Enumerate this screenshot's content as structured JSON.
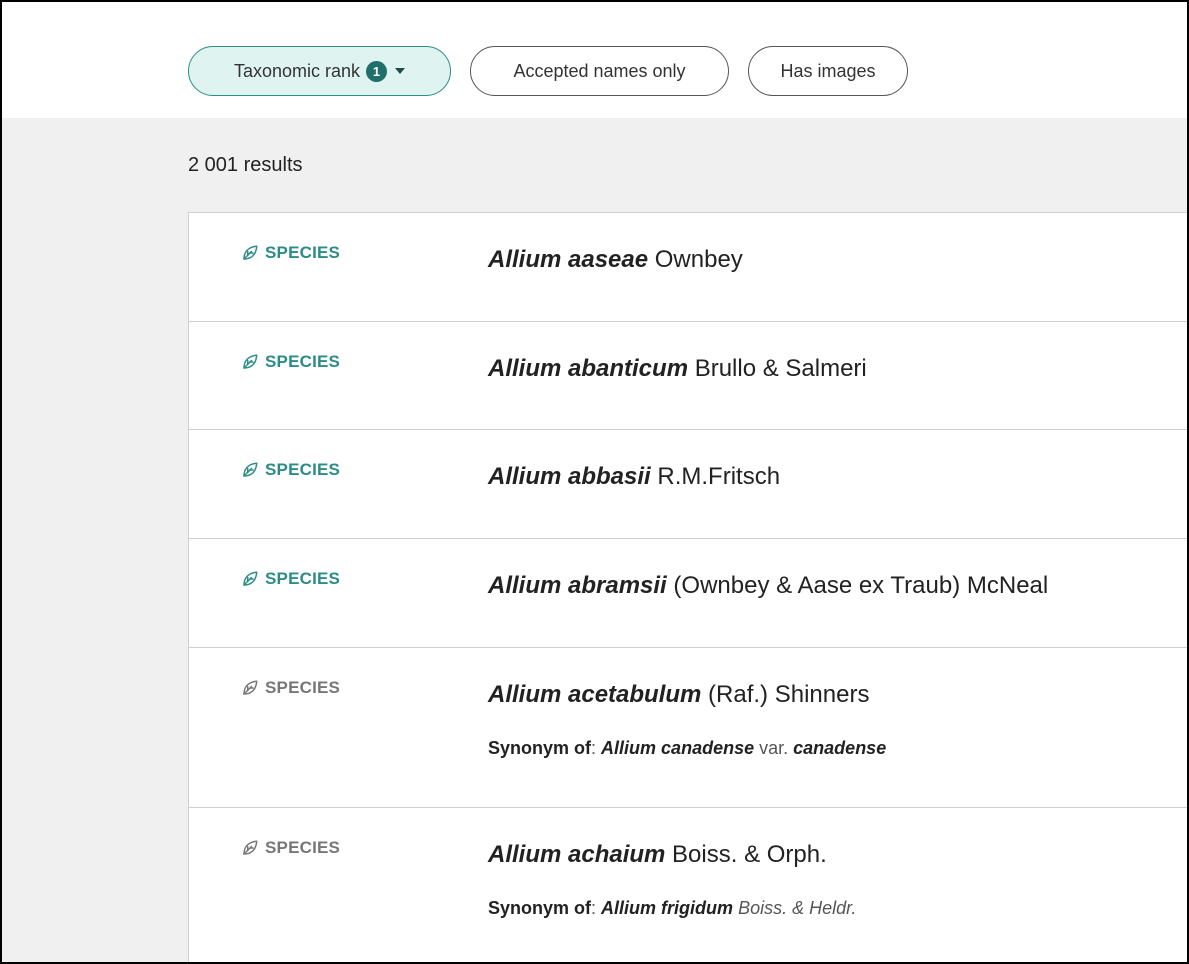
{
  "filters": {
    "taxonomic_rank": {
      "label": "Taxonomic rank",
      "count": "1"
    },
    "accepted_only": {
      "label": "Accepted names only"
    },
    "has_images": {
      "label": "Has images"
    }
  },
  "results": {
    "count_text": "2 001 results",
    "items": [
      {
        "rank": "SPECIES",
        "status": "accepted",
        "name": "Allium aaseae",
        "author": "Ownbey"
      },
      {
        "rank": "SPECIES",
        "status": "accepted",
        "name": "Allium abanticum",
        "author": "Brullo & Salmeri"
      },
      {
        "rank": "SPECIES",
        "status": "accepted",
        "name": "Allium abbasii",
        "author": "R.M.Fritsch"
      },
      {
        "rank": "SPECIES",
        "status": "accepted",
        "name": "Allium abramsii",
        "author": "(Ownbey & Aase ex Traub) McNeal"
      },
      {
        "rank": "SPECIES",
        "status": "synonym",
        "name": "Allium acetabulum",
        "author": "(Raf.) Shinners",
        "synonym_label": "Synonym of",
        "synonym_name": "Allium canadense",
        "synonym_rank": "var.",
        "synonym_infra": "canadense"
      },
      {
        "rank": "SPECIES",
        "status": "synonym",
        "name": "Allium achaium",
        "author": "Boiss. & Orph.",
        "synonym_label": "Synonym of",
        "synonym_name": "Allium frigidum",
        "synonym_author": "Boiss. & Heldr."
      }
    ]
  },
  "colors": {
    "accent": "#2b8d86",
    "accent_dark": "#1f6f6a",
    "active_chip_bg": "#dff3f1",
    "muted_rank": "#777777",
    "panel_bg": "#f0f0f0"
  },
  "icons": {
    "rank_icon": "leaf-icon",
    "dropdown_icon": "caret-down-icon"
  }
}
